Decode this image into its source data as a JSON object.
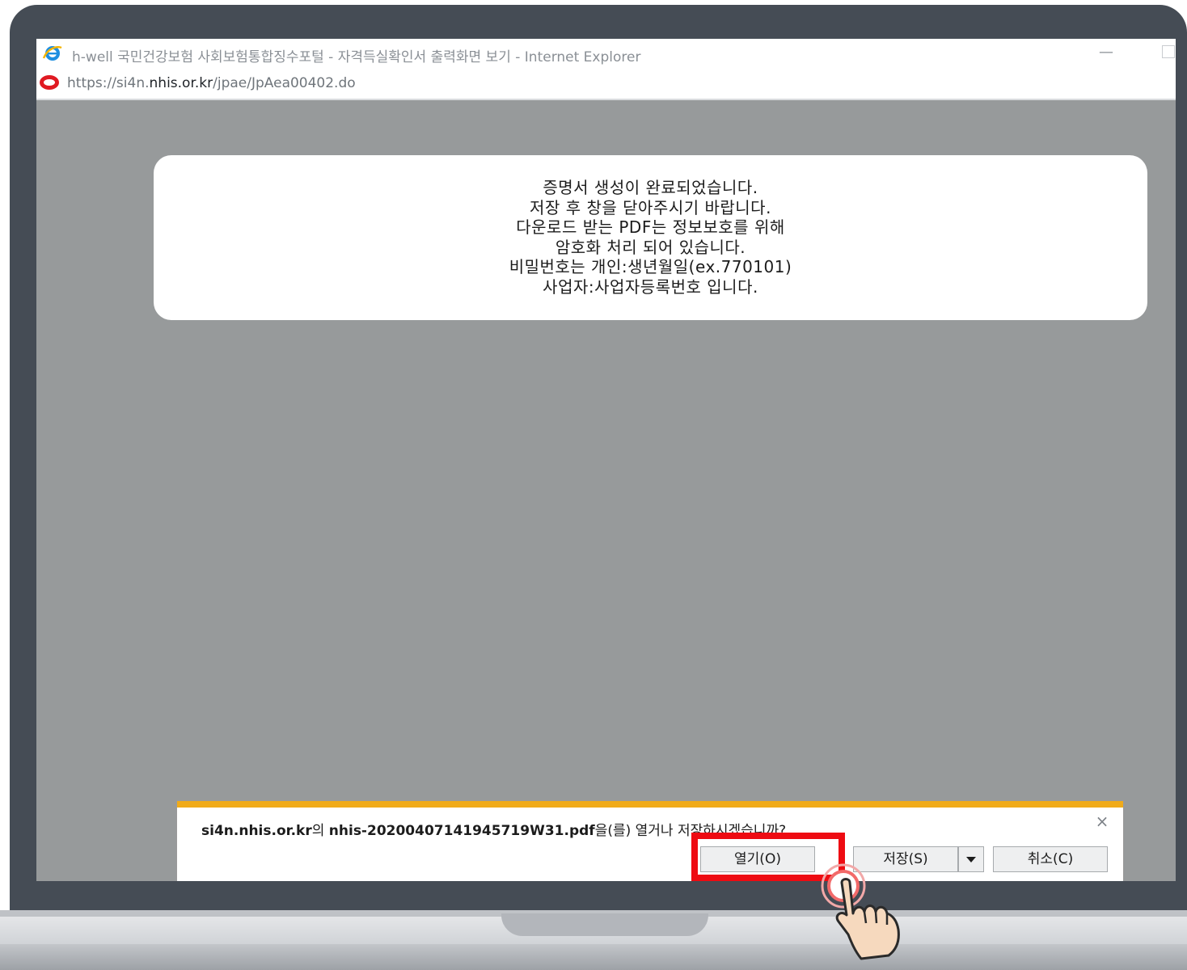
{
  "window": {
    "title": "h-well 국민건강보험 사회보험통합징수포털 - 자격득실확인서 출력화면 보기 - Internet Explorer",
    "minimize_symbol": "—"
  },
  "address": {
    "prefix": "https://si4n.",
    "host": "nhis.or.kr",
    "path": "/jpae/JpAea00402.do"
  },
  "notice": {
    "lines": [
      "증명서 생성이 완료되었습니다.",
      "저장 후 창을 닫아주시기 바랍니다.",
      "다운로드 받는 PDF는 정보보호를 위해",
      "암호화 처리 되어 있습니다.",
      "비밀번호는 개인:생년월일(ex.770101)",
      "사업자:사업자등록번호 입니다."
    ]
  },
  "download_bar": {
    "domain": "si4n.nhis.or.kr",
    "possessive": "의 ",
    "filename": "nhis-20200407141945719W31.pdf",
    "question": "을(를) 열거나 저장하시겠습니까?",
    "close_symbol": "×",
    "open_label": "열기(O)",
    "save_label": "저장(S)",
    "cancel_label": "취소(C)"
  },
  "colors": {
    "accent_bar": "#f0ab1a",
    "highlight": "#ee0b12",
    "page_background": "#979a9b"
  },
  "icons": {
    "browser": "internet-explorer-icon",
    "site": "site-favicon-icon",
    "pointer": "hand-pointer-icon"
  }
}
